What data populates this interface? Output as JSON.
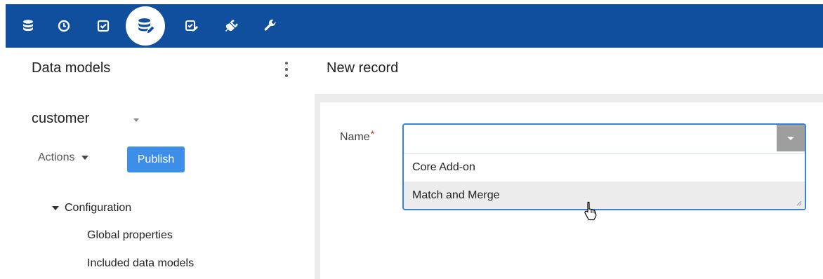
{
  "toolbar": {
    "icons": [
      "database-icon",
      "history-clock-icon",
      "checkbox-icon",
      "data-model-icon",
      "checklist-edit-icon",
      "plugin-icon",
      "wrench-icon"
    ],
    "active_index": 3,
    "color": "#0f4f9e"
  },
  "left_panel": {
    "title": "Data models",
    "model_name": "customer",
    "actions_label": "Actions",
    "publish_label": "Publish",
    "tree": {
      "root_label": "Configuration",
      "children": [
        "Global properties",
        "Included data models"
      ]
    }
  },
  "main": {
    "title": "New record",
    "form": {
      "name_label": "Name",
      "required_mark": "*",
      "name_value": "",
      "options": [
        "Core Add-on",
        "Match and Merge"
      ],
      "hovered_option": "Match and Merge"
    }
  },
  "colors": {
    "accent": "#3d8ee8",
    "focus_border": "#3b82d6",
    "required": "#d9342b"
  }
}
